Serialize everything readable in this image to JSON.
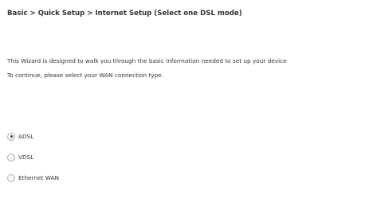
{
  "header": {
    "breadcrumb": "Basic > Quick Setup > Internet Setup (Select one DSL mode)"
  },
  "intro": {
    "line1": "This Wizard is designed to walk you through the basic information needed to set up your device",
    "line2": "To continue, please select your WAN connection type."
  },
  "wan_modes": {
    "selected": "ADSL",
    "options": [
      {
        "label": "ADSL",
        "checked": true
      },
      {
        "label": "VDSL",
        "checked": false
      },
      {
        "label": "Ethernet WAN",
        "checked": false
      }
    ]
  }
}
